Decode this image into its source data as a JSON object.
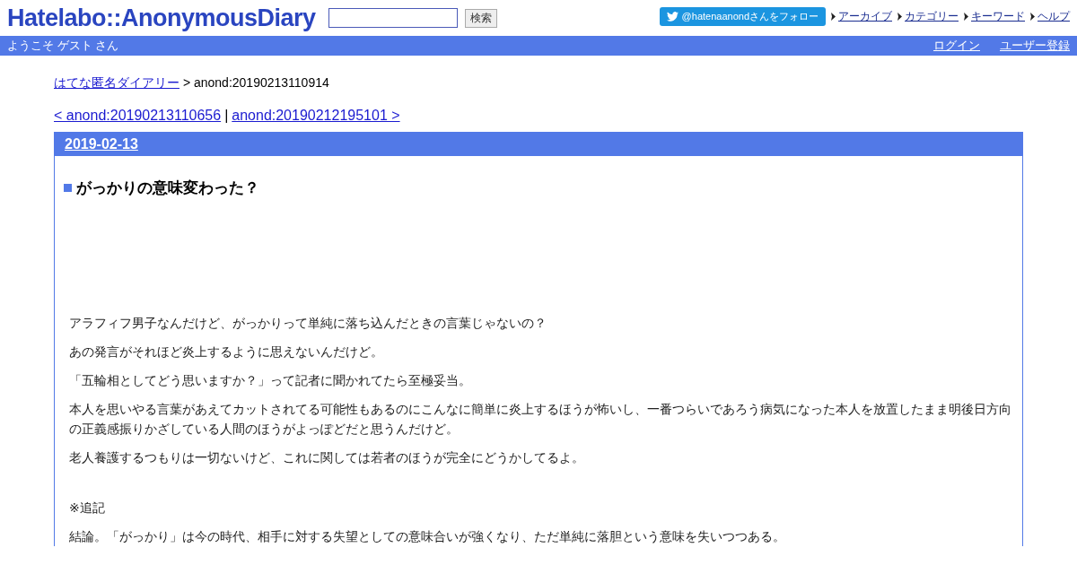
{
  "header": {
    "logo": "Hatelabo::AnonymousDiary",
    "search": {
      "button": "検索"
    },
    "follow_button": "@hatenaanondさんをフォロー",
    "links": [
      "アーカイブ",
      "カテゴリー",
      "キーワード",
      "ヘルプ"
    ]
  },
  "user_bar": {
    "welcome": "ようこそ ゲスト さん",
    "links": [
      "ログイン",
      "ユーザー登録"
    ]
  },
  "breadcrumb": {
    "link": "はてな匿名ダイアリー",
    "current": "> anond:20190213110914"
  },
  "pager": {
    "prev": "< anond:20190213110656",
    "separator": "|",
    "next": "anond:20190212195101 >"
  },
  "day": {
    "date": "2019-02-13",
    "title": "がっかりの意味変わった？",
    "paragraphs": [
      {
        "kind": "text",
        "text": "アラフィフ男子なんだけど、がっかりって単純に落ち込んだときの言葉じゃないの？"
      },
      {
        "kind": "text",
        "text": "あの発言がそれほど炎上するように思えないんだけど。"
      },
      {
        "kind": "text",
        "text": "「五輪相としてどう思いますか？」って記者に聞かれてたら至極妥当。"
      },
      {
        "kind": "text",
        "text": "本人を思いやる言葉があえてカットされてる可能性もあるのにこんなに簡単に炎上するほうが怖いし、一番つらいであろう病気になった本人を放置したまま明後日方向の正義感振りかざしている人間のほうがよっぽどだと思うんだけど。"
      },
      {
        "kind": "text",
        "text": "老人養護するつもりは一切ないけど、これに関しては若者のほうが完全にどうかしてるよ。"
      },
      {
        "kind": "gap"
      },
      {
        "kind": "text",
        "text": "※追記"
      },
      {
        "kind": "text",
        "text": "結論。「がっかり」は今の時代、相手に対する失望としての意味合いが強くなり、ただ単純に落胆という意味を失いつつある。"
      }
    ]
  }
}
